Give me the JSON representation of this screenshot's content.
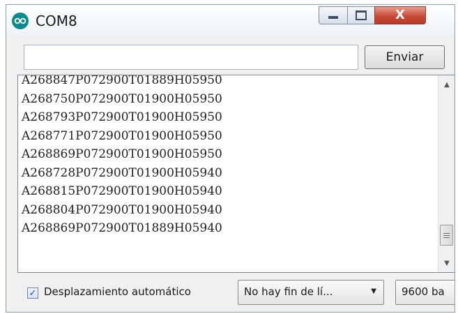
{
  "window": {
    "title": "COM8",
    "icon": "arduino-infinity-icon",
    "controls": {
      "minimize_icon": "minimize-icon",
      "maximize_icon": "maximize-icon",
      "close_icon": "close-icon",
      "close_glyph": "X"
    }
  },
  "send": {
    "input_value": "",
    "input_placeholder": "",
    "button_label": "Enviar"
  },
  "output": {
    "lines": [
      "A268847P072900T01889H05950",
      "A268750P072900T01900H05950",
      "A268793P072900T01900H05950",
      "A268771P072900T01900H05950",
      "A268869P072900T01900H05950",
      "A268728P072900T01900H05940",
      "A268815P072900T01900H05940",
      "A268804P072900T01900H05940",
      "A268869P072900T01889H05940"
    ]
  },
  "footer": {
    "autoscroll_label": "Desplazamiento automático",
    "autoscroll_checked": true,
    "line_ending_value": "No hay fin de lí...",
    "baud_value": "9600 ba"
  },
  "colors": {
    "app_icon": "#0d8a8c",
    "close_button": "#c84a36"
  }
}
